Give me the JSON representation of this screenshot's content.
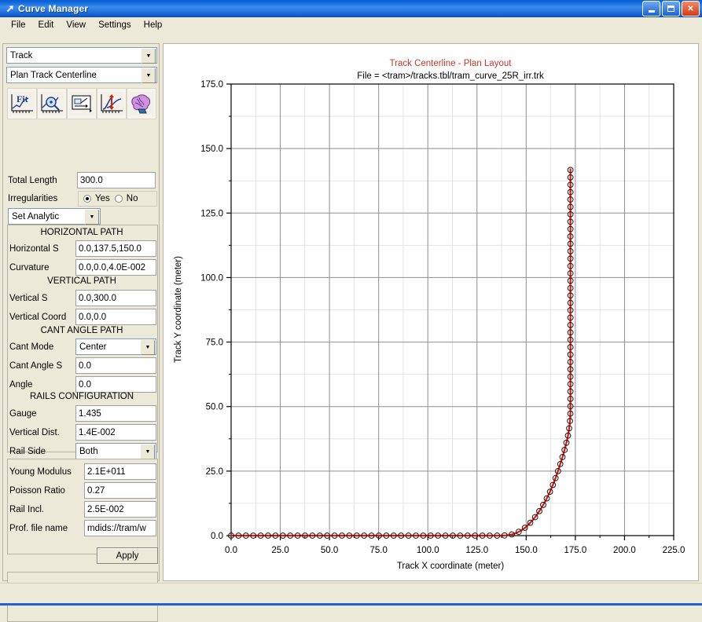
{
  "window": {
    "title": "Curve Manager",
    "icon": "curve-icon",
    "buttons": {
      "minimize": "minimize",
      "maximize": "maximize",
      "close": "close"
    }
  },
  "menu": [
    "File",
    "Edit",
    "View",
    "Settings",
    "Help"
  ],
  "sidebar": {
    "object_combo": {
      "value": "Track",
      "caret": "▼"
    },
    "view_combo": {
      "value": "Plan Track Centerline",
      "caret": "▼"
    },
    "toolbar": [
      {
        "name": "fit-curve-icon",
        "label": "Fit"
      },
      {
        "name": "zoom-data-icon",
        "label": "Zoom"
      },
      {
        "name": "edit-properties-icon",
        "label": "Edit"
      },
      {
        "name": "difference-icon",
        "label": "Diff"
      },
      {
        "name": "intelligent-fit-icon",
        "label": "Auto"
      }
    ],
    "total_length": {
      "label": "Total Length",
      "value": "300.0"
    },
    "irregularities": {
      "label": "Irregularities",
      "yes": "Yes",
      "no": "No",
      "selected": "Yes"
    },
    "mode_combo": {
      "value": "Set Analytic",
      "caret": "▼"
    },
    "sections": [
      {
        "title": "HORIZONTAL PATH",
        "fields": [
          {
            "label": "Horizontal S",
            "value": "0.0,137.5,150.0"
          },
          {
            "label": "Curvature",
            "value": "0.0,0.0,4.0E-002"
          }
        ]
      },
      {
        "title": "VERTICAL PATH",
        "fields": [
          {
            "label": "Vertical S",
            "value": "0.0,300.0"
          },
          {
            "label": "Vertical Coord",
            "value": "0.0,0.0"
          }
        ]
      },
      {
        "title": "CANT ANGLE PATH",
        "fields": [
          {
            "label": "Cant Mode",
            "value": "Center",
            "type": "combo"
          },
          {
            "label": "Cant Angle S",
            "value": "0.0"
          },
          {
            "label": "Angle",
            "value": "0.0"
          }
        ]
      },
      {
        "title": "RAILS CONFIGURATION",
        "fields": [
          {
            "label": "Gauge",
            "value": "1.435"
          },
          {
            "label": "Vertical Dist.",
            "value": "1.4E-002"
          },
          {
            "label": "Rail Side",
            "value": "Both",
            "type": "combo"
          }
        ]
      }
    ],
    "rail_props": [
      {
        "label": "Young Modulus",
        "value": "2.1E+011"
      },
      {
        "label": "Poisson Ratio",
        "value": "0.27"
      },
      {
        "label": "Rail Incl.",
        "value": "2.5E-002"
      },
      {
        "label": "Prof. file name",
        "value": "mdids://tram/w"
      }
    ],
    "apply_label": "Apply"
  },
  "chart_data": {
    "type": "line",
    "title": "Track Centerline - Plan Layout",
    "subtitle": "File = <tram>/tracks.tbl/tram_curve_25R_irr.trk",
    "title_color": "#c0392b",
    "series_color": "#e8140a",
    "marker": "open-circle",
    "xlabel": "Track X coordinate (meter)",
    "ylabel": "Track Y coordinate (meter)",
    "xlim": [
      0.0,
      225.0
    ],
    "ylim": [
      0.0,
      175.0
    ],
    "xticks": [
      0.0,
      25.0,
      50.0,
      75.0,
      100.0,
      125.0,
      150.0,
      175.0,
      200.0,
      225.0
    ],
    "yticks": [
      0.0,
      25.0,
      50.0,
      75.0,
      100.0,
      125.0,
      150.0,
      175.0
    ],
    "xtick_labels": [
      "0.0",
      "25.0",
      "50.0",
      "75.0",
      "100.0",
      "125.0",
      "150.0",
      "175.0",
      "200.0",
      "225.0"
    ],
    "ytick_labels": [
      "0.0",
      "25.0",
      "50.0",
      "75.0",
      "100.0",
      "125.0",
      "150.0",
      "175.0"
    ],
    "minor_tick_step": 12.5,
    "grid": true,
    "legend": "none",
    "series": [
      {
        "name": "Track centerline",
        "x": [
          0.0,
          5.0,
          10.0,
          15.0,
          20.0,
          25.0,
          30.0,
          35.0,
          40.0,
          45.0,
          50.0,
          55.0,
          60.0,
          65.0,
          70.0,
          75.0,
          80.0,
          85.0,
          90.0,
          95.0,
          100.0,
          105.0,
          110.0,
          115.0,
          120.0,
          125.0,
          130.0,
          135.0,
          137.5,
          140.0,
          142.5,
          145.0,
          147.5,
          150.0,
          152.5,
          155.0,
          157.5,
          160.0,
          162.0,
          164.0,
          166.0,
          168.0,
          169.5,
          170.8,
          171.6,
          172.1,
          172.4,
          172.5,
          172.5,
          172.5,
          172.5,
          172.5,
          172.5,
          172.5,
          172.5,
          172.5,
          172.5,
          172.5,
          172.5,
          172.5,
          172.5,
          172.5,
          172.5,
          172.5
        ],
        "y": [
          0.0,
          0.0,
          0.0,
          0.0,
          0.0,
          0.0,
          0.0,
          0.0,
          0.0,
          0.0,
          0.0,
          0.0,
          0.0,
          0.0,
          0.0,
          0.0,
          0.0,
          0.0,
          0.0,
          0.0,
          0.0,
          0.0,
          0.0,
          0.0,
          0.0,
          0.0,
          0.0,
          0.0,
          0.0,
          0.1,
          0.4,
          1.0,
          2.0,
          3.4,
          5.3,
          7.6,
          10.4,
          13.7,
          16.8,
          20.4,
          24.6,
          29.3,
          33.2,
          37.0,
          40.2,
          43.0,
          45.4,
          48.0,
          52.0,
          56.5,
          61.5,
          67.0,
          73.0,
          79.0,
          85.5,
          92.0,
          98.5,
          105.0,
          111.5,
          118.0,
          124.0,
          130.0,
          136.0,
          142.0
        ]
      }
    ]
  }
}
